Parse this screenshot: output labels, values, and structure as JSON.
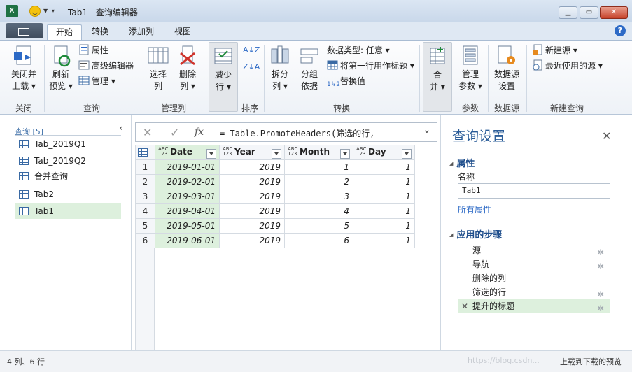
{
  "window": {
    "title": "Tab1 - 查询编辑器",
    "app_logo": "X",
    "icons": [
      "excel-icon",
      "smiley-icon",
      "qat-arrow-icon"
    ],
    "buttons": {
      "minimize": "▁",
      "restore": "▭",
      "close": "✕"
    }
  },
  "tabs": [
    {
      "label": "开始",
      "active": true
    },
    {
      "label": "转换"
    },
    {
      "label": "添加列"
    },
    {
      "label": "视图"
    }
  ],
  "help_label": "?",
  "ribbon": {
    "close_group": {
      "label": "关闭",
      "close_load": "关闭并",
      "close_load2": "上载 ▾"
    },
    "query_group": {
      "label": "查询",
      "refresh": "刷新",
      "refresh2": "预览 ▾",
      "properties": "属性",
      "advanced_editor": "高级编辑器",
      "manage": "管理 ▾"
    },
    "manage_cols_group": {
      "label": "管理列",
      "choose_cols": "选择",
      "choose_cols2": "列",
      "remove_cols": "删除",
      "remove_cols2": "列 ▾"
    },
    "reduce_rows": {
      "label": "减少",
      "label2": "行 ▾"
    },
    "sort_group": {
      "label": "排序",
      "az": "A↓Z",
      "za": "Z↓A"
    },
    "transform_group": {
      "label": "转换",
      "split": "拆分",
      "split2": "列 ▾",
      "group_by": "分组",
      "group_by2": "依据",
      "data_type": "数据类型: 任意 ▾",
      "first_row_header": "将第一行用作标题 ▾",
      "replace_values": "替换值"
    },
    "combine": {
      "label": "合",
      "label2": "并 ▾"
    },
    "params_group": {
      "label": "参数",
      "manage_params": "管理",
      "manage_params2": "参数 ▾"
    },
    "datasource_group": {
      "label": "数据源",
      "ds_settings": "数据源",
      "ds_settings2": "设置"
    },
    "new_query_group": {
      "label": "新建查询",
      "new_source": "新建源 ▾",
      "recent_sources": "最近使用的源 ▾"
    }
  },
  "queries": {
    "header": "查询 [5]",
    "collapse_icon": "‹",
    "items": [
      {
        "name": "Tab_2019Q1"
      },
      {
        "name": "Tab_2019Q2"
      },
      {
        "name": "合并查询"
      },
      {
        "name": "Tab2"
      },
      {
        "name": "Tab1",
        "selected": true
      }
    ]
  },
  "formula": {
    "cancel_icon": "✕",
    "commit_icon": "✓",
    "fx_label": "fx",
    "text": "= Table.PromoteHeaders(筛选的行,",
    "expand_icon": "⌄"
  },
  "grid": {
    "type_badge": "ABC\n123",
    "columns": [
      "Date",
      "Year",
      "Month",
      "Day"
    ],
    "rows": [
      [
        "1",
        "2019-01-01",
        "2019",
        "1",
        "1"
      ],
      [
        "2",
        "2019-02-01",
        "2019",
        "2",
        "1"
      ],
      [
        "3",
        "2019-03-01",
        "2019",
        "3",
        "1"
      ],
      [
        "4",
        "2019-04-01",
        "2019",
        "4",
        "1"
      ],
      [
        "5",
        "2019-05-01",
        "2019",
        "5",
        "1"
      ],
      [
        "6",
        "2019-06-01",
        "2019",
        "6",
        "1"
      ]
    ]
  },
  "settings": {
    "title": "查询设置",
    "close_icon": "✕",
    "properties_header": "属性",
    "name_label": "名称",
    "name_value": "Tab1",
    "all_properties": "所有属性",
    "steps_header": "应用的步骤",
    "steps": [
      {
        "label": "源",
        "gear": true
      },
      {
        "label": "导航",
        "gear": true
      },
      {
        "label": "删除的列",
        "gear": false
      },
      {
        "label": "筛选的行",
        "gear": true
      },
      {
        "label": "提升的标题",
        "gear": true,
        "selected": true
      }
    ],
    "step_delete_icon": "✕"
  },
  "status": {
    "left": "4 列、6 行",
    "right": "上载到下载的预览"
  },
  "watermark": "https://blog.csdn..."
}
